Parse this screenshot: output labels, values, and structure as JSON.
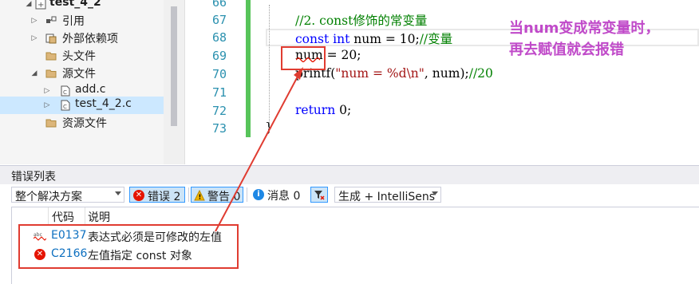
{
  "solution_explorer": {
    "items": [
      {
        "label": "test_4_2",
        "expander": "◢",
        "icon": "project-icon",
        "bold": true
      },
      {
        "label": "引用",
        "expander": "▷",
        "icon": "references-icon"
      },
      {
        "label": "外部依赖项",
        "expander": "▷",
        "icon": "external-deps-icon"
      },
      {
        "label": "头文件",
        "expander": "",
        "icon": "folder-icon"
      },
      {
        "label": "源文件",
        "expander": "◢",
        "icon": "folder-icon"
      },
      {
        "label": "add.c",
        "expander": "▷",
        "icon": "c-file-icon"
      },
      {
        "label": "test_4_2.c",
        "expander": "▷",
        "icon": "c-file-icon",
        "selected": true
      },
      {
        "label": "资源文件",
        "expander": "",
        "icon": "folder-icon"
      }
    ]
  },
  "editor": {
    "line_numbers": [
      "66",
      "67",
      "68",
      "69",
      "70",
      "71",
      "72",
      "73"
    ],
    "code": {
      "l67_comment": "//2. const修饰的常变量",
      "l68_kw1": "const",
      "l68_kw2": "int",
      "l68_rest": "num = 10;",
      "l68_comment": "//变量",
      "l69": "num = 20;",
      "l70_fn": "printf(",
      "l70_str": "\"num = %d\\n\"",
      "l70_rest": ", num);",
      "l70_comment": "//20",
      "l72_kw": "return",
      "l72_rest": "0;",
      "l73": "}"
    }
  },
  "annotation": {
    "line1": "当num变成常变量时，",
    "line2": "再去赋值就会报错",
    "color": "#c04ac9"
  },
  "error_list": {
    "title": "错误列表",
    "scope": "整个解决方案",
    "errors_btn": "错误 2",
    "warnings_btn": "警告 0",
    "messages_btn": "消息 0",
    "build_filter": "生成 + IntelliSens",
    "columns": {
      "code": "代码",
      "description": "说明"
    },
    "rows": [
      {
        "code": "E0137",
        "description": "表达式必须是可修改的左值",
        "icon": "intellisense-error-icon"
      },
      {
        "code": "C2166",
        "description": "左值指定 const 对象",
        "icon": "error-circle-icon"
      }
    ]
  },
  "colors": {
    "highlight_red": "#e03c31",
    "error_red": "#e51400",
    "accent_blue": "#3399ff"
  }
}
